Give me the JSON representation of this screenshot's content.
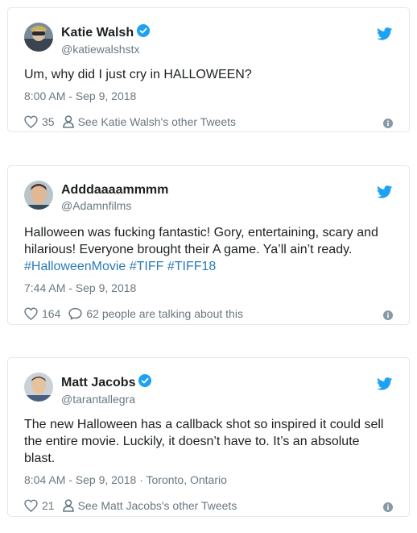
{
  "tweets": [
    {
      "display_name": "Katie Walsh",
      "handle": "@katiewalshstx",
      "verified": true,
      "text": "Um, why did I just cry in HALLOWEEN?",
      "hashtags": "",
      "timestamp": "8:00 AM - Sep 9, 2018",
      "location": "",
      "likes": "35",
      "secondary_label": "See Katie Walsh's other Tweets",
      "secondary_icon": "person-icon"
    },
    {
      "display_name": "Adddaaaammmm",
      "handle": "@Adamnfilms",
      "verified": false,
      "text": "Halloween was fucking fantastic! Gory, entertaining, scary and hilarious! Everyone brought their A game. Ya’ll ain’t ready.",
      "hashtags": "#HalloweenMovie #TIFF #TIFF18",
      "timestamp": "7:44 AM - Sep 9, 2018",
      "location": "",
      "likes": "164",
      "secondary_label": "62 people are talking about this",
      "secondary_icon": "reply-bubble-icon"
    },
    {
      "display_name": "Matt Jacobs",
      "handle": "@tarantallegra",
      "verified": true,
      "text": "The new Halloween has a callback shot so inspired it could sell the entire movie. Luckily, it doesn’t have to. It’s an absolute blast.",
      "hashtags": "",
      "timestamp": "8:04 AM - Sep 9, 2018",
      "location": " · Toronto, Ontario",
      "likes": "21",
      "secondary_label": "See Matt Jacobs's other Tweets",
      "secondary_icon": "person-icon"
    }
  ],
  "colors": {
    "twitter_blue": "#1da1f2",
    "link": "#2b7bb9",
    "muted": "#697882",
    "border": "#e1e8ed"
  }
}
